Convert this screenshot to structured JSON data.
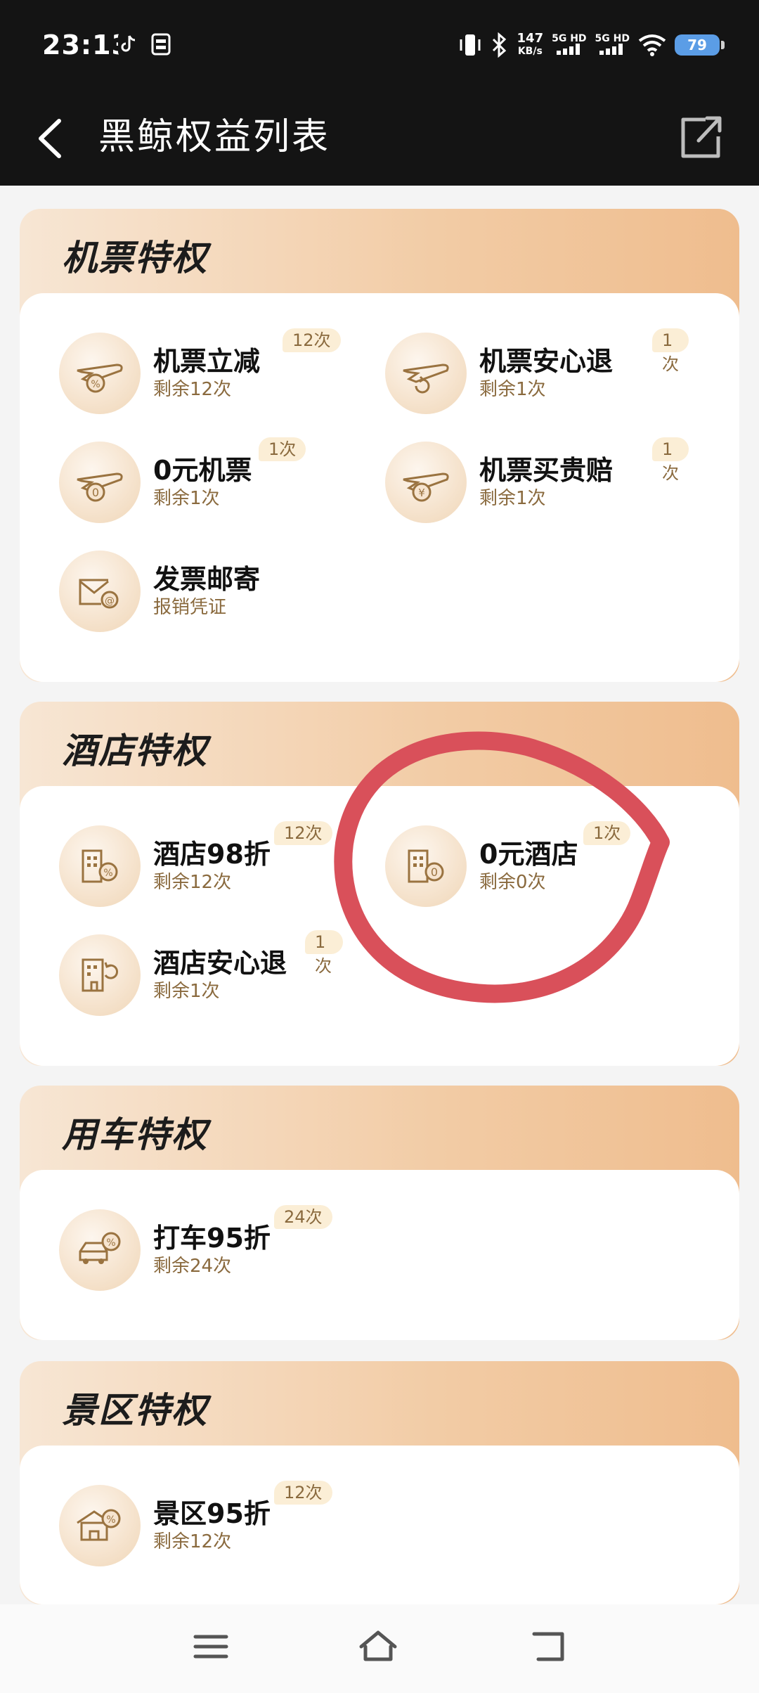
{
  "status_bar": {
    "time": "23:13",
    "net_speed_value": "147",
    "net_speed_unit": "KB/s",
    "signal1": "5G HD",
    "signal2": "5G HD",
    "battery": "79"
  },
  "header": {
    "title": "黑鲸权益列表"
  },
  "sections": [
    {
      "title": "机票特权",
      "items": [
        {
          "name": "机票立减",
          "sub": "剩余12次",
          "badge": "12次",
          "icon": "plane-discount-icon"
        },
        {
          "name": "机票安心退",
          "sub": "剩余1次",
          "badge": "1次",
          "icon": "plane-refund-icon"
        },
        {
          "name": "0元机票",
          "sub": "剩余1次",
          "badge": "1次",
          "icon": "plane-free-icon"
        },
        {
          "name": "机票买贵赔",
          "sub": "剩余1次",
          "badge": "1次",
          "icon": "plane-yen-icon"
        },
        {
          "name": "发票邮寄",
          "sub": "报销凭证",
          "badge": "",
          "icon": "invoice-mail-icon"
        }
      ]
    },
    {
      "title": "酒店特权",
      "items": [
        {
          "name": "酒店98折",
          "sub": "剩余12次",
          "badge": "12次",
          "icon": "hotel-discount-icon"
        },
        {
          "name": "0元酒店",
          "sub": "剩余0次",
          "badge": "1次",
          "icon": "hotel-free-icon"
        },
        {
          "name": "酒店安心退",
          "sub": "剩余1次",
          "badge": "1次",
          "icon": "hotel-refund-icon"
        }
      ]
    },
    {
      "title": "用车特权",
      "items": [
        {
          "name": "打车95折",
          "sub": "剩余24次",
          "badge": "24次",
          "icon": "taxi-discount-icon"
        }
      ]
    },
    {
      "title": "景区特权",
      "items": [
        {
          "name": "景区95折",
          "sub": "剩余12次",
          "badge": "12次",
          "icon": "scenic-discount-icon"
        }
      ]
    }
  ],
  "colors": {
    "header_bg": "#141414",
    "card_gradient_start": "#f7e6d4",
    "card_gradient_end": "#efbd8e",
    "sub_text": "#8a6a3e",
    "annotation_circle": "#d9505a"
  }
}
